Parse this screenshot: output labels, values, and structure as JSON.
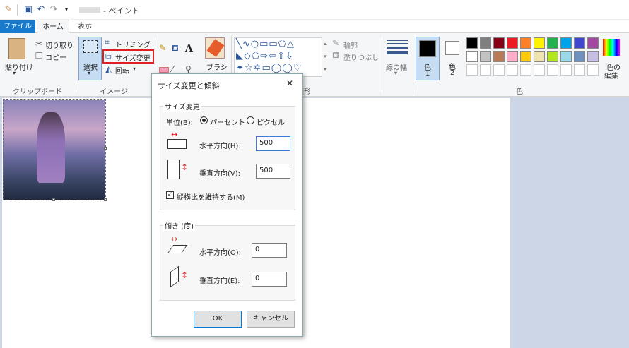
{
  "window": {
    "title": "- ペイント",
    "qat": {
      "undo": "↶",
      "redo": "↷"
    }
  },
  "tabs": {
    "file": "ファイル",
    "home": "ホーム",
    "view": "表示"
  },
  "clipboard": {
    "paste": "貼り付け",
    "cut": "切り取り",
    "copy": "コピー",
    "group": "クリップボード"
  },
  "image": {
    "select": "選択",
    "crop": "トリミング",
    "resize": "サイズ変更",
    "rotate": "回転",
    "group": "イメージ"
  },
  "tools": {
    "brush": "ブラシ"
  },
  "shapes": {
    "outline": "輪郭",
    "fill": "塗りつぶし",
    "group": "図形"
  },
  "size": {
    "label": "線の幅"
  },
  "colors": {
    "color1": "色",
    "color1_num": "1",
    "color2": "色",
    "color2_num": "2",
    "group": "色",
    "edit1": "色の",
    "edit2": "編集",
    "palette_row1": [
      "#000000",
      "#7f7f7f",
      "#880015",
      "#ed1c24",
      "#ff7f27",
      "#fff200",
      "#22b14c",
      "#00a2e8",
      "#3f48cc",
      "#a349a4"
    ],
    "palette_row2": [
      "#ffffff",
      "#c3c3c3",
      "#b97a57",
      "#ffaec9",
      "#ffc90e",
      "#efe4b0",
      "#b5e61d",
      "#99d9ea",
      "#7092be",
      "#c8bfe7"
    ]
  },
  "dialog": {
    "title": "サイズ変更と傾斜",
    "resize_section": "サイズ変更",
    "unit_label": "単位(B):",
    "percent": "パーセント",
    "pixel": "ピクセル",
    "h_label": "水平方向(H):",
    "h_value": "500",
    "v_label": "垂直方向(V):",
    "v_value": "500",
    "keep_ratio": "縦横比を維持する(M)",
    "skew_section": "傾き (度)",
    "skew_h_label": "水平方向(O):",
    "skew_h_value": "0",
    "skew_v_label": "垂直方向(E):",
    "skew_v_value": "0",
    "ok": "OK",
    "cancel": "キャンセル",
    "close": "✕"
  }
}
